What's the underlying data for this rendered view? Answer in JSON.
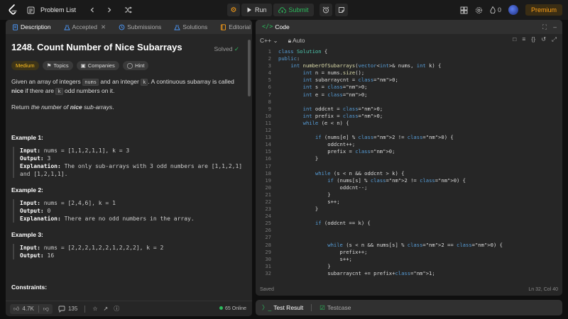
{
  "header": {
    "problem_list": "Problem List",
    "run": "Run",
    "submit": "Submit",
    "coins": "0",
    "premium": "Premium"
  },
  "tabs": {
    "description": "Description",
    "accepted": "Accepted",
    "submissions": "Submissions",
    "solutions": "Solutions",
    "editorial": "Editorial",
    "code": "Code",
    "test_result": "Test Result",
    "testcase": "Testcase"
  },
  "problem": {
    "title": "1248. Count Number of Nice Subarrays",
    "solved": "Solved",
    "difficulty": "Medium",
    "topics": "Topics",
    "companies": "Companies",
    "hint": "Hint",
    "desc_1": "Given an array of integers",
    "desc_nums": "nums",
    "desc_2": "and an integer",
    "desc_k": "k",
    "desc_3": ". A continuous subarray is called",
    "desc_nice": "nice",
    "desc_4": "if there are",
    "desc_5": "odd numbers on it.",
    "return_1": "Return",
    "return_2": "the number of",
    "return_3": "nice",
    "return_4": "sub-arrays",
    "return_5": ".",
    "examples": [
      {
        "title": "Example 1:",
        "input": "nums = [1,1,2,1,1], k = 3",
        "output": "3",
        "explanation": "The only sub-arrays with 3 odd numbers are [1,1,2,1] and [1,2,1,1]."
      },
      {
        "title": "Example 2:",
        "input": "nums = [2,4,6], k = 1",
        "output": "0",
        "explanation": "There are no odd numbers in the array."
      },
      {
        "title": "Example 3:",
        "input": "nums = [2,2,2,1,2,2,1,2,2,2], k = 2",
        "output": "16",
        "explanation": ""
      }
    ],
    "labels": {
      "input": "Input:",
      "output": "Output:",
      "explanation": "Explanation:"
    },
    "constraints": "Constraints:"
  },
  "footer": {
    "likes": "4.7K",
    "comments": "135",
    "online": "65 Online"
  },
  "editor": {
    "language": "C++",
    "auto": "Auto",
    "status_left": "Saved",
    "status_right": "Ln 32, Col 40",
    "lines": [
      "class Solution {",
      "public:",
      "    int numberOfSubarrays(vector<int>& nums, int k) {",
      "        int n = nums.size();",
      "        int subarraycnt = 0;",
      "        int s = 0;",
      "        int e = 0;",
      "",
      "        int oddcnt = 0;",
      "        int prefix = 0;",
      "        while (e < n) {",
      "",
      "            if (nums[e] % 2 != 0) {",
      "                oddcnt++;",
      "                prefix = 0;",
      "            }",
      "",
      "            while (s < n && oddcnt > k) {",
      "                if (nums[s] % 2 != 0) {",
      "                    oddcnt--;",
      "                }",
      "                s++;",
      "            }",
      "",
      "            if (oddcnt == k) {",
      "",
      "",
      "                while (s < n && nums[s] % 2 == 0) {",
      "                    prefix++;",
      "                    s++;",
      "                }",
      "                subarraycnt += prefix+1;"
    ]
  }
}
